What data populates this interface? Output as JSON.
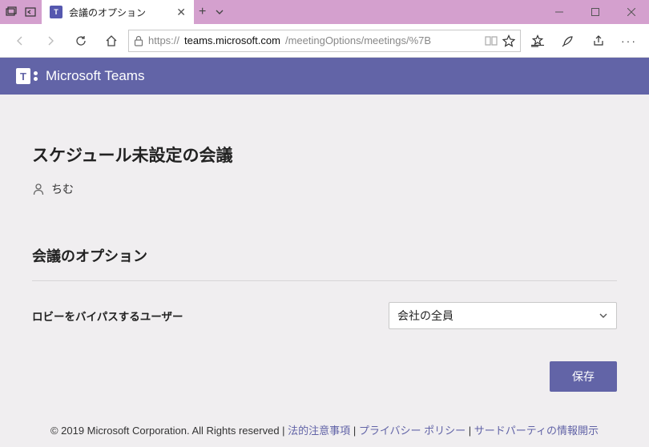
{
  "tab": {
    "title": "会議のオプション"
  },
  "url": {
    "host": "teams.microsoft.com",
    "path": "/meetingOptions/meetings/%7B",
    "scheme": "https://"
  },
  "teamsHeader": {
    "product": "Microsoft Teams"
  },
  "meeting": {
    "title": "スケジュール未設定の会議",
    "organizer": "ちむ"
  },
  "optionsSection": {
    "heading": "会議のオプション",
    "lobbyBypass": {
      "label": "ロビーをバイパスするユーザー",
      "value": "会社の全員"
    },
    "saveLabel": "保存"
  },
  "footer": {
    "copyright": "© 2019 Microsoft Corporation. All Rights reserved",
    "legal": "法的注意事項",
    "privacy": "プライバシー ポリシー",
    "thirdParty": "サードパーティの情報開示"
  }
}
